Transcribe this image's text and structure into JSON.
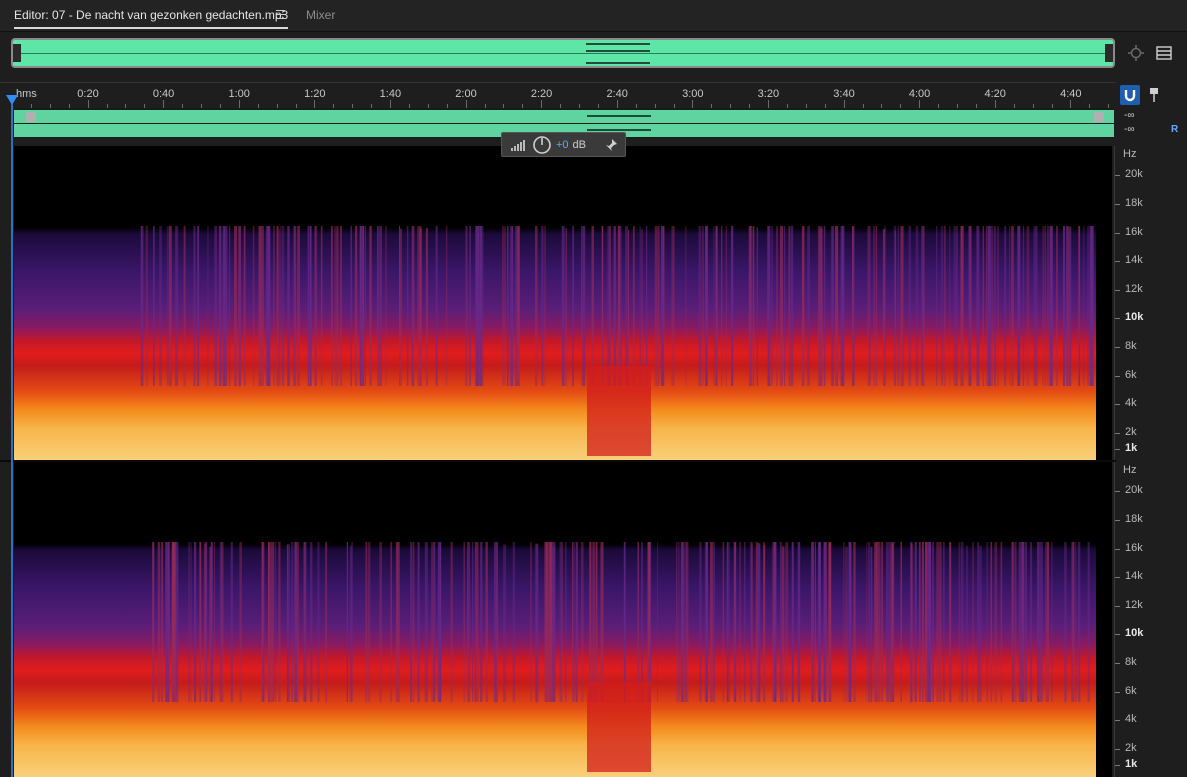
{
  "tabs": {
    "editor_label": "Editor: 07 - De nacht van gezonken gedachten.mp3",
    "mixer_label": "Mixer"
  },
  "ruler": {
    "unit": "hms",
    "labels": [
      "0:20",
      "0:40",
      "1:00",
      "1:20",
      "1:40",
      "2:00",
      "2:20",
      "2:40",
      "3:00",
      "3:20",
      "3:40",
      "4:00",
      "4:20",
      "4:40"
    ]
  },
  "track": {
    "level_left": "-∞",
    "level_right": "-∞",
    "channel_right": "R"
  },
  "hud": {
    "gain_value": "+0",
    "gain_unit": "dB"
  },
  "freq_axis": {
    "unit": "Hz",
    "labels": [
      "20k",
      "18k",
      "16k",
      "14k",
      "12k",
      "10k",
      "8k",
      "6k",
      "4k",
      "2k",
      "1k"
    ]
  },
  "colors": {
    "accent": "#2f8ff0",
    "waveform": "#5ee6a8"
  }
}
